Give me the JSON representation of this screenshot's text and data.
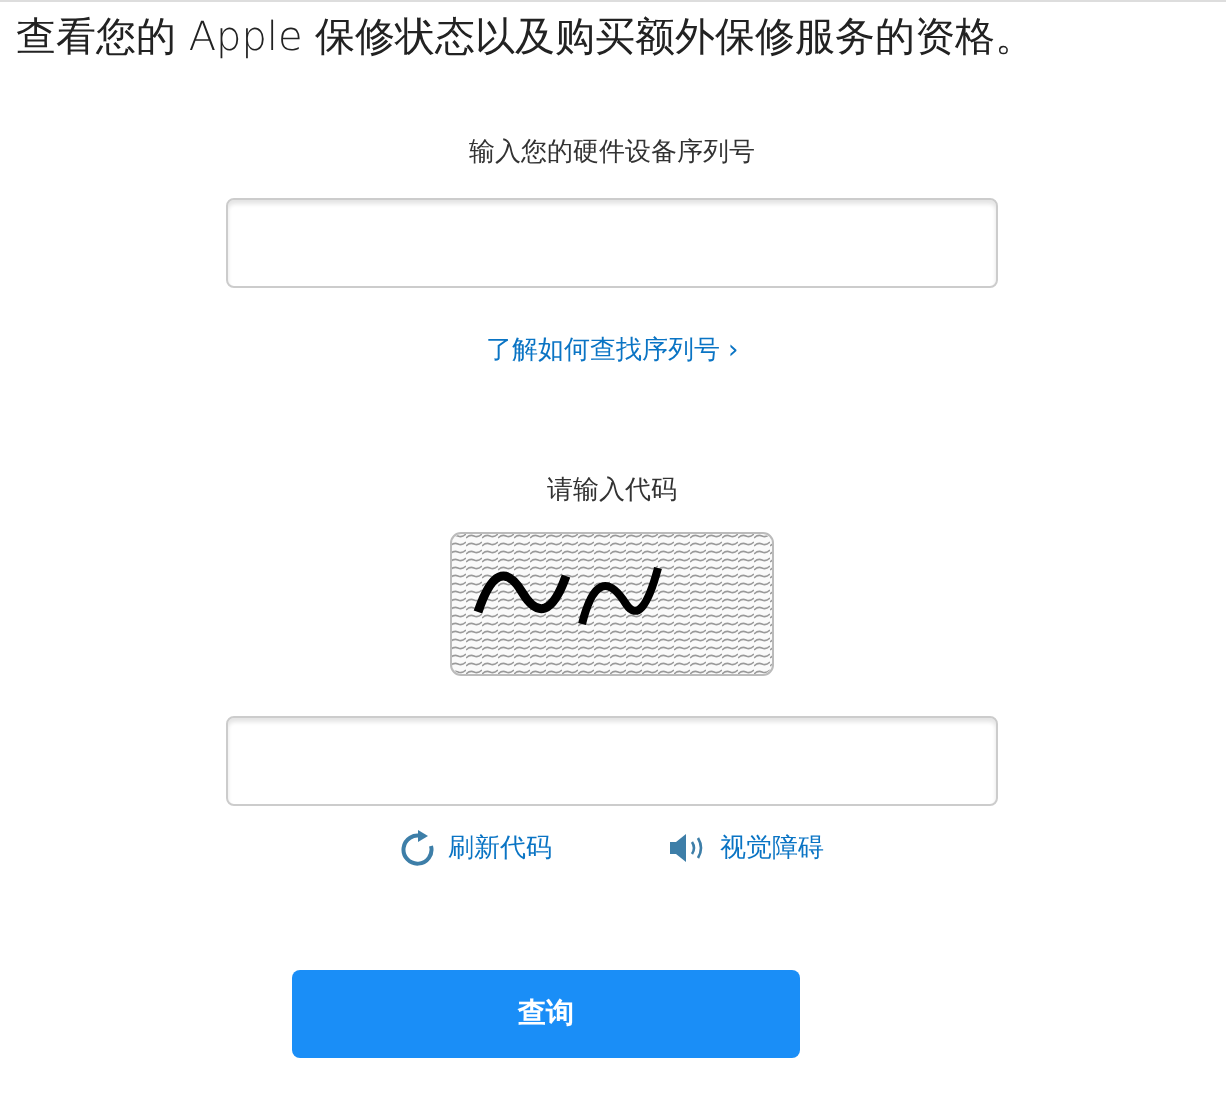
{
  "heading": "查看您的 Apple 保修状态以及购买额外保修服务的资格。",
  "serial": {
    "label": "输入您的硬件设备序列号"
  },
  "help_link": {
    "text": "了解如何查找序列号",
    "chevron": "›"
  },
  "captcha": {
    "label": "请输入代码"
  },
  "actions": [
    {
      "kind": "refresh",
      "label": "刷新代码"
    },
    {
      "kind": "audio",
      "label": "视觉障碍"
    }
  ],
  "submit": {
    "label": "查询"
  }
}
